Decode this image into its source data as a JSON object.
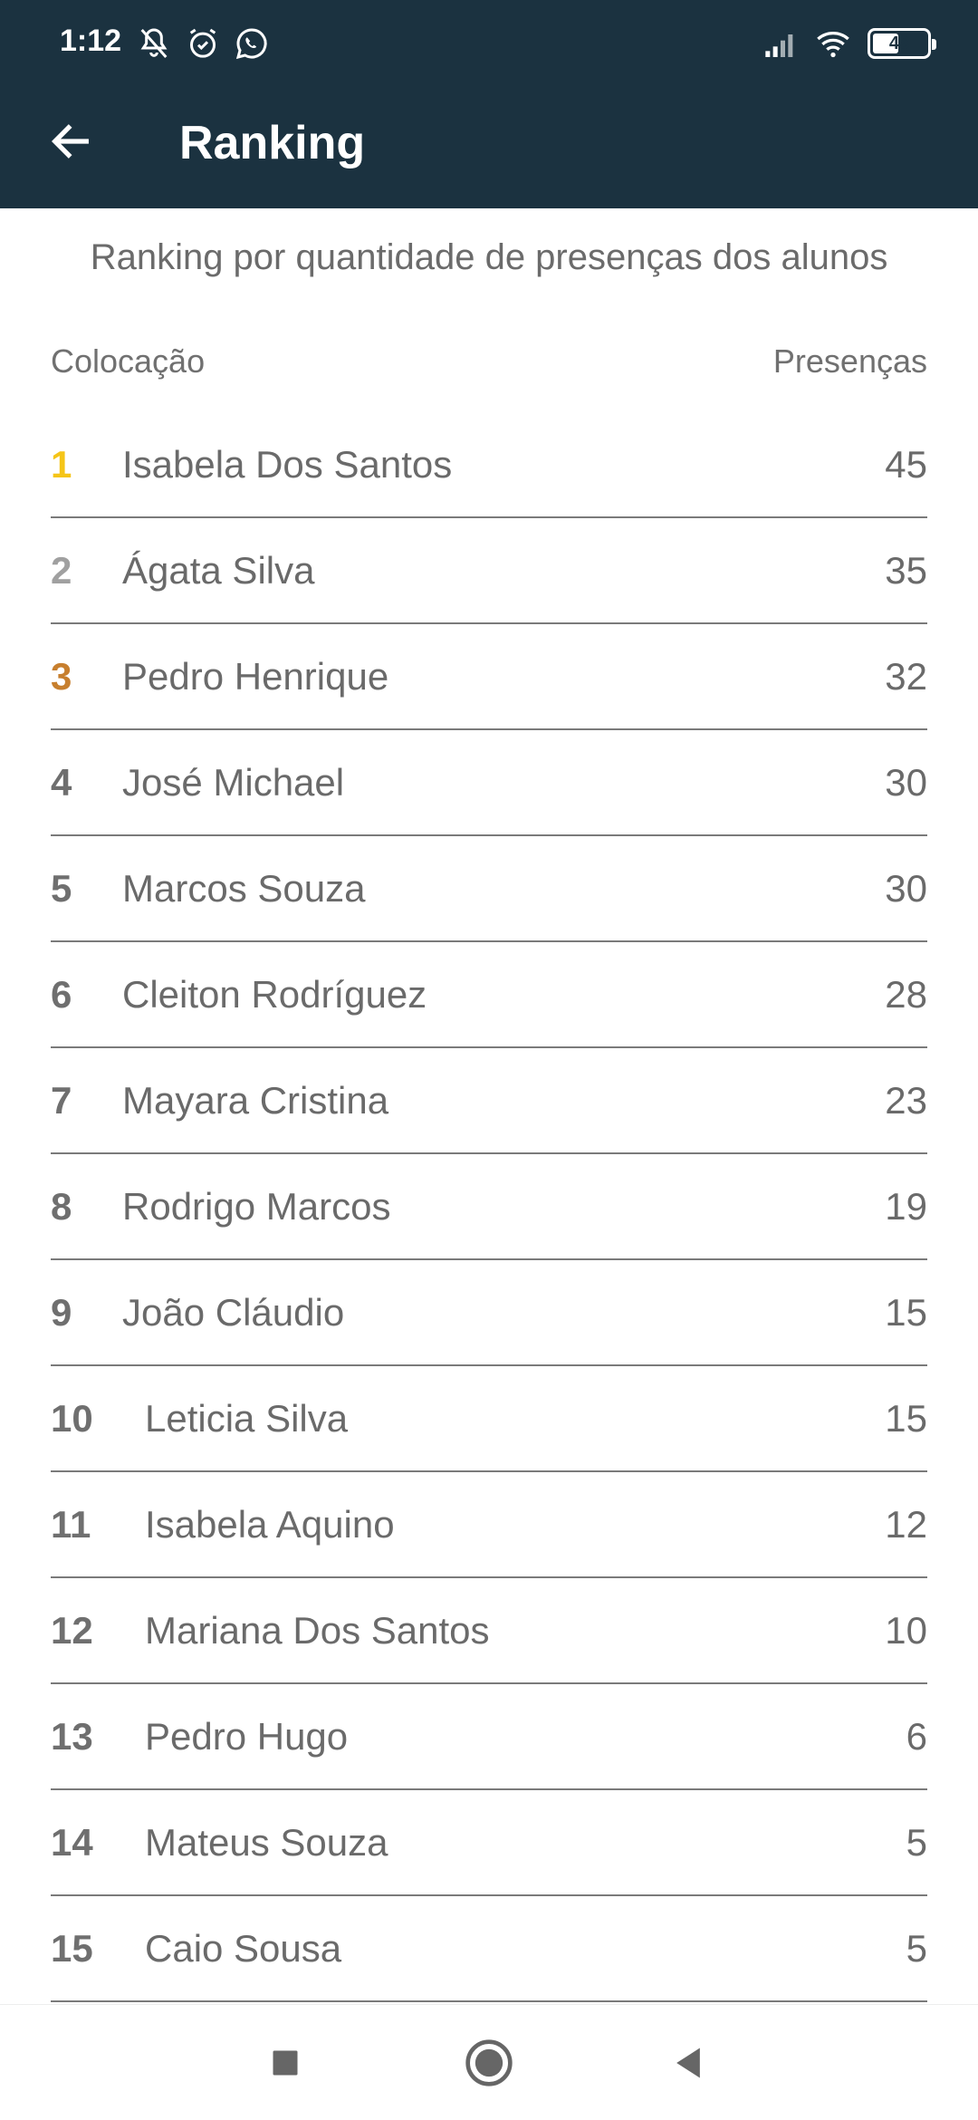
{
  "status": {
    "time": "1:12",
    "battery": "48",
    "battery_level": 0.48
  },
  "header": {
    "title": "Ranking"
  },
  "subtitle": "Ranking por quantidade de presenças dos alunos",
  "columns": {
    "left": "Colocação",
    "right": "Presenças"
  },
  "rank_colors": {
    "first": "#f5c518",
    "second": "#a0a0a0",
    "third": "#c77f2e",
    "default": "#6f6f6f"
  },
  "ranking": [
    {
      "rank": "1",
      "name": "Isabela Dos Santos",
      "count": "45"
    },
    {
      "rank": "2",
      "name": "Ágata Silva",
      "count": "35"
    },
    {
      "rank": "3",
      "name": "Pedro Henrique",
      "count": "32"
    },
    {
      "rank": "4",
      "name": "José Michael",
      "count": "30"
    },
    {
      "rank": "5",
      "name": "Marcos Souza",
      "count": "30"
    },
    {
      "rank": "6",
      "name": "Cleiton Rodríguez",
      "count": "28"
    },
    {
      "rank": "7",
      "name": "Mayara Cristina",
      "count": "23"
    },
    {
      "rank": "8",
      "name": "Rodrigo Marcos",
      "count": "19"
    },
    {
      "rank": "9",
      "name": "João Cláudio",
      "count": "15"
    },
    {
      "rank": "10",
      "name": "Leticia Silva",
      "count": "15"
    },
    {
      "rank": "11",
      "name": "Isabela Aquino",
      "count": "12"
    },
    {
      "rank": "12",
      "name": "Mariana Dos Santos",
      "count": "10"
    },
    {
      "rank": "13",
      "name": "Pedro Hugo",
      "count": "6"
    },
    {
      "rank": "14",
      "name": "Mateus Souza",
      "count": "5"
    },
    {
      "rank": "15",
      "name": "Caio Sousa",
      "count": "5"
    }
  ],
  "icons": {
    "back": "arrow-left-icon",
    "nav_recents": "square-icon",
    "nav_home": "circle-icon",
    "nav_back": "triangle-back-icon"
  }
}
